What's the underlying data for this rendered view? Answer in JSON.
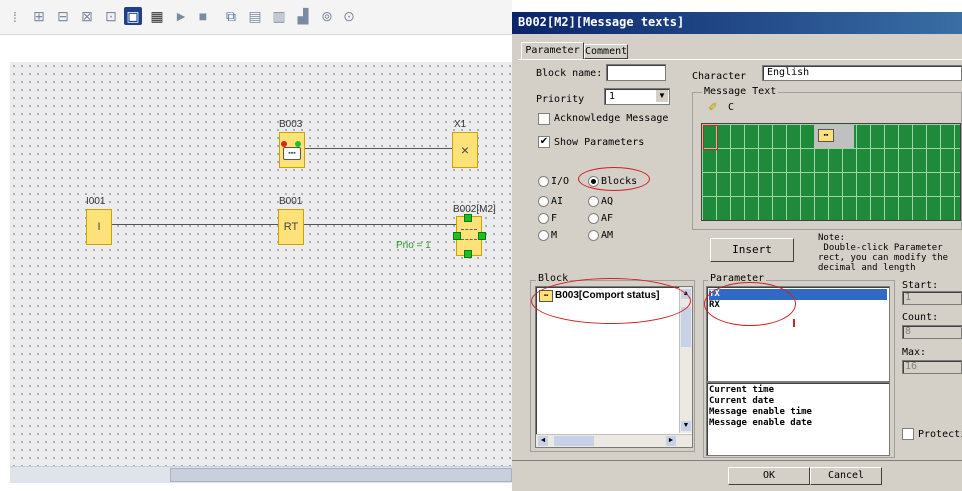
{
  "editor": {
    "toolbar_icons": [
      "toolbar-icon-1",
      "toolbar-icon-2",
      "toolbar-icon-3",
      "toolbar-icon-4",
      "toolbar-icon-5",
      "toolbar-icon-6",
      "toolbar-icon-7",
      "toolbar-icon-8",
      "toolbar-icon-9",
      "toolbar-icon-10",
      "toolbar-icon-11",
      "toolbar-icon-12",
      "toolbar-icon-13",
      "toolbar-icon-14"
    ],
    "blocks": {
      "b003": {
        "label": "B003"
      },
      "x1": {
        "label": "X1",
        "symbol": "×"
      },
      "i001": {
        "label": "I001",
        "symbol": "I"
      },
      "b001": {
        "label": "B001",
        "symbol": "RT"
      },
      "b002": {
        "label": "B002[M2]",
        "prio": "Prio = 1"
      }
    }
  },
  "dialog": {
    "title": "B002[M2][Message texts]",
    "tabs": {
      "parameter": "Parameter",
      "comment": "Comment"
    },
    "block_name_label": "Block name:",
    "priority_label": "Priority",
    "priority_value": "1",
    "acknowledge_label": "Acknowledge Message",
    "show_params_label": "Show Parameters",
    "character_label": "Character",
    "character_value": "English",
    "message_text_label": "Message Text",
    "cursor_char": "C",
    "radios": {
      "io": "I/O",
      "blocks": "Blocks",
      "ai": "AI",
      "aq": "AQ",
      "f": "F",
      "af": "AF",
      "m": "M",
      "am": "AM"
    },
    "insert_label": "Insert",
    "note_text": "Note:\n Double-click Parameter\nrect, you can modify the\ndecimal and length",
    "block_group_label": "Block",
    "block_item": "B003[Comport status]",
    "parameter_group_label": "Parameter",
    "parameter_items": [
      "TX",
      "RX"
    ],
    "time_items": [
      "Current time",
      "Current date",
      "Message enable time",
      "Message enable date"
    ],
    "start_label": "Start:",
    "start_value": "1",
    "count_label": "Count:",
    "count_value": "8",
    "max_label": "Max:",
    "max_value": "16",
    "protection_label": "Protecti",
    "ok_label": "OK",
    "cancel_label": "Cancel"
  }
}
